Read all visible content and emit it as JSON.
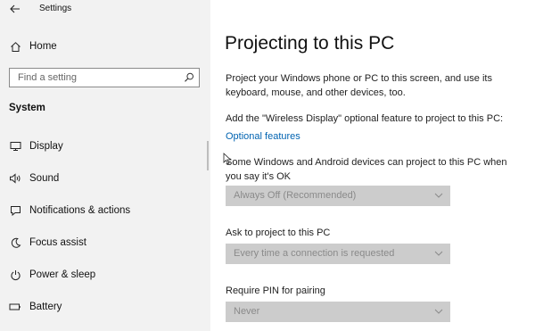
{
  "window": {
    "title": "Settings"
  },
  "sidebar": {
    "home_label": "Home",
    "search_placeholder": "Find a setting",
    "section_title": "System",
    "items": [
      {
        "label": "Display",
        "icon": "monitor-icon"
      },
      {
        "label": "Sound",
        "icon": "speaker-icon"
      },
      {
        "label": "Notifications & actions",
        "icon": "notification-icon"
      },
      {
        "label": "Focus assist",
        "icon": "moon-icon"
      },
      {
        "label": "Power & sleep",
        "icon": "power-icon"
      },
      {
        "label": "Battery",
        "icon": "battery-icon"
      }
    ]
  },
  "main": {
    "title": "Projecting to this PC",
    "intro": "Project your Windows phone or PC to this screen, and use its keyboard, mouse, and other devices, too.",
    "feature_note": "Add the \"Wireless Display\" optional feature to project to this PC:",
    "optional_features_link": "Optional features",
    "availability_label": "Some Windows and Android devices can project to this PC when you say it's OK",
    "availability_value": "Always Off (Recommended)",
    "ask_label": "Ask to project to this PC",
    "ask_value": "Every time a connection is requested",
    "pin_label": "Require PIN for pairing",
    "pin_value": "Never"
  },
  "colors": {
    "sidebar_bg": "#f2f2f2",
    "link": "#0063b1",
    "dropdown_bg": "#cccccc"
  }
}
